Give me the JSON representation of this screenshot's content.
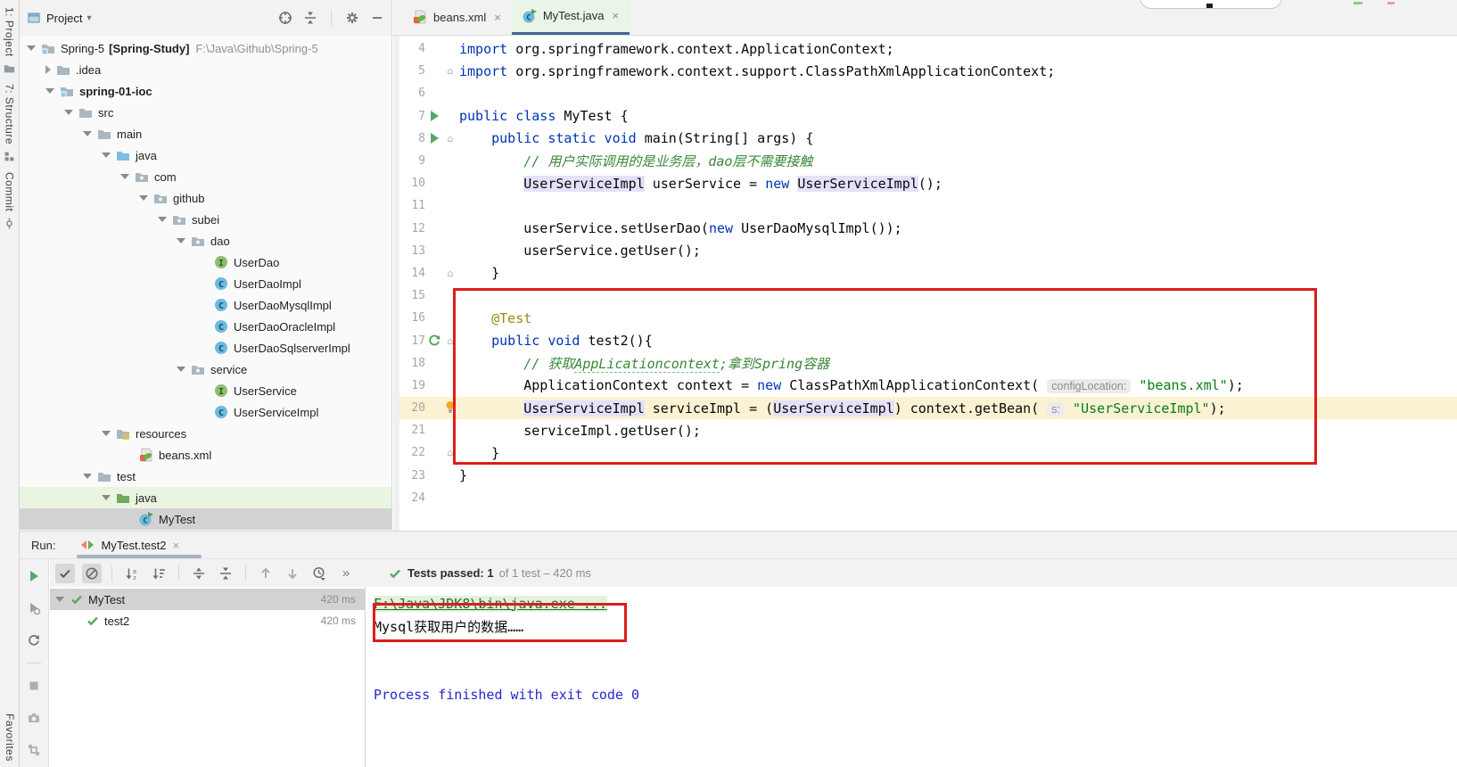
{
  "left_bar": {
    "top_items": [
      {
        "label": "1: Project",
        "icon": "folder-mini"
      },
      {
        "label": "7: Structure",
        "icon": "structure"
      },
      {
        "label": "Commit",
        "icon": "commit"
      }
    ],
    "bottom_items": [
      {
        "label": "Favorites",
        "icon": null
      }
    ]
  },
  "project_panel": {
    "title": "Project",
    "caret": "▾",
    "actions": [
      "target",
      "collapse-all",
      "sep",
      "gear",
      "minimize"
    ],
    "tree": [
      {
        "indent": 0,
        "chevron": "open",
        "icon": "module",
        "label": "Spring-5",
        "extra": "[Spring-Study]",
        "path": "F:\\Java\\Github\\Spring-5"
      },
      {
        "indent": 1,
        "chevron": "closed",
        "icon": "folder",
        "label": ".idea"
      },
      {
        "indent": 1,
        "chevron": "open",
        "icon": "module",
        "label": "spring-01-ioc",
        "bold": true
      },
      {
        "indent": 2,
        "chevron": "open",
        "icon": "folder",
        "label": "src"
      },
      {
        "indent": 3,
        "chevron": "open",
        "icon": "folder",
        "label": "main"
      },
      {
        "indent": 4,
        "chevron": "open",
        "icon": "folder-blue",
        "label": "java"
      },
      {
        "indent": 5,
        "chevron": "open",
        "icon": "package",
        "label": "com"
      },
      {
        "indent": 6,
        "chevron": "open",
        "icon": "package",
        "label": "github"
      },
      {
        "indent": 7,
        "chevron": "open",
        "icon": "package",
        "label": "subei"
      },
      {
        "indent": 8,
        "chevron": "open",
        "icon": "package",
        "label": "dao"
      },
      {
        "indent": 9,
        "chevron": "none",
        "icon": "interface",
        "label": "UserDao"
      },
      {
        "indent": 9,
        "chevron": "none",
        "icon": "class",
        "label": "UserDaoImpl"
      },
      {
        "indent": 9,
        "chevron": "none",
        "icon": "class",
        "label": "UserDaoMysqlImpl"
      },
      {
        "indent": 9,
        "chevron": "none",
        "icon": "class",
        "label": "UserDaoOracleImpl"
      },
      {
        "indent": 9,
        "chevron": "none",
        "icon": "class",
        "label": "UserDaoSqlserverImpl"
      },
      {
        "indent": 8,
        "chevron": "open",
        "icon": "package",
        "label": "service"
      },
      {
        "indent": 9,
        "chevron": "none",
        "icon": "interface",
        "label": "UserService"
      },
      {
        "indent": 9,
        "chevron": "none",
        "icon": "class",
        "label": "UserServiceImpl"
      },
      {
        "indent": 4,
        "chevron": "open",
        "icon": "resources",
        "label": "resources"
      },
      {
        "indent": 5,
        "chevron": "none",
        "icon": "spring",
        "label": "beans.xml"
      },
      {
        "indent": 3,
        "chevron": "open",
        "icon": "folder",
        "label": "test"
      },
      {
        "indent": 4,
        "chevron": "open",
        "icon": "folder-green",
        "label": "java",
        "row": "green"
      },
      {
        "indent": 5,
        "chevron": "none",
        "icon": "class-run",
        "label": "MyTest",
        "row": "selected"
      }
    ]
  },
  "editor": {
    "tabs": [
      {
        "label": "beans.xml",
        "icon": "spring",
        "close": "×",
        "active": false
      },
      {
        "label": "MyTest.java",
        "icon": "class-run",
        "close": "×",
        "active": true
      }
    ],
    "lines": [
      {
        "n": 4,
        "seg": [
          {
            "t": "import",
            "c": "kw"
          },
          {
            "t": " org.springframework.context.ApplicationContext;",
            "c": "pl"
          }
        ]
      },
      {
        "n": 5,
        "fold": true,
        "seg": [
          {
            "t": "import",
            "c": "kw"
          },
          {
            "t": " org.springframework.context.support.ClassPathXmlApplicationContext;",
            "c": "pl"
          }
        ]
      },
      {
        "n": 6,
        "seg": []
      },
      {
        "n": 7,
        "g": "play-green",
        "seg": [
          {
            "t": "public class",
            "c": "kw"
          },
          {
            "t": " MyTest {",
            "c": "pl"
          }
        ]
      },
      {
        "n": 8,
        "g": "play-green",
        "fold": true,
        "seg": [
          {
            "t": "    ",
            "c": "pl"
          },
          {
            "t": "public static void",
            "c": "kw"
          },
          {
            "t": " main(String[] args) {",
            "c": "pl"
          }
        ]
      },
      {
        "n": 9,
        "seg": [
          {
            "t": "        ",
            "c": "pl"
          },
          {
            "t": "// 用户实际调用的是业务层，dao层不需要接触",
            "c": "cm"
          }
        ]
      },
      {
        "n": 10,
        "seg": [
          {
            "t": "        ",
            "c": "pl"
          },
          {
            "t": "UserServiceImpl",
            "c": "hl"
          },
          {
            "t": " userService = ",
            "c": "pl"
          },
          {
            "t": "new",
            "c": "kw"
          },
          {
            "t": " ",
            "c": "pl"
          },
          {
            "t": "UserServiceImpl",
            "c": "hl"
          },
          {
            "t": "();",
            "c": "pl"
          }
        ]
      },
      {
        "n": 11,
        "seg": []
      },
      {
        "n": 12,
        "seg": [
          {
            "t": "        userService.setUserDao(",
            "c": "pl"
          },
          {
            "t": "new",
            "c": "kw"
          },
          {
            "t": " UserDaoMysqlImpl());",
            "c": "pl"
          }
        ]
      },
      {
        "n": 13,
        "seg": [
          {
            "t": "        userService.getUser();",
            "c": "pl"
          }
        ]
      },
      {
        "n": 14,
        "fold": true,
        "seg": [
          {
            "t": "    }",
            "c": "pl"
          }
        ]
      },
      {
        "n": 15,
        "seg": []
      },
      {
        "n": 16,
        "seg": [
          {
            "t": "    ",
            "c": "pl"
          },
          {
            "t": "@Test",
            "c": "ann"
          }
        ]
      },
      {
        "n": 17,
        "g": "rerun-green",
        "fold": true,
        "seg": [
          {
            "t": "    ",
            "c": "pl"
          },
          {
            "t": "public void",
            "c": "kw"
          },
          {
            "t": " test2(){",
            "c": "pl"
          }
        ]
      },
      {
        "n": 18,
        "seg": [
          {
            "t": "        ",
            "c": "pl"
          },
          {
            "t": "// 获取",
            "c": "cm"
          },
          {
            "t": "AppLicationcontext",
            "c": "cmu"
          },
          {
            "t": ";拿到Spring容器",
            "c": "cm"
          }
        ]
      },
      {
        "n": 19,
        "seg": [
          {
            "t": "        ApplicationContext context = ",
            "c": "pl"
          },
          {
            "t": "new",
            "c": "kw"
          },
          {
            "t": " ClassPathXmlApplicationContext( ",
            "c": "pl"
          },
          {
            "t": "configLocation:",
            "c": "hint"
          },
          {
            "t": " ",
            "c": "pl"
          },
          {
            "t": "\"beans.xml\"",
            "c": "str"
          },
          {
            "t": ");",
            "c": "pl"
          }
        ]
      },
      {
        "n": 20,
        "current": true,
        "bulb": true,
        "seg": [
          {
            "t": "        ",
            "c": "pl"
          },
          {
            "t": "UserServiceImpl",
            "c": "hl"
          },
          {
            "t": " serviceImpl = (",
            "c": "pl"
          },
          {
            "t": "UserServiceImpl",
            "c": "hl"
          },
          {
            "t": ") context.getBean( ",
            "c": "pl"
          },
          {
            "t": "s:",
            "c": "hint"
          },
          {
            "t": " ",
            "c": "pl"
          },
          {
            "t": "\"UserServiceImpl\"",
            "c": "str"
          },
          {
            "t": ");",
            "c": "pl"
          }
        ]
      },
      {
        "n": 21,
        "seg": [
          {
            "t": "        serviceImpl.getUser();",
            "c": "pl"
          }
        ]
      },
      {
        "n": 22,
        "fold": true,
        "seg": [
          {
            "t": "    }",
            "c": "pl"
          }
        ]
      },
      {
        "n": 23,
        "seg": [
          {
            "t": "}",
            "c": "pl"
          }
        ]
      },
      {
        "n": 24,
        "seg": []
      }
    ]
  },
  "run_panel": {
    "label": "Run:",
    "tab": {
      "label": "MyTest.test2",
      "icon": "junit",
      "close": "×"
    },
    "strip": [
      "play-green",
      "rerun-failed",
      "refresh",
      "sep",
      "stop",
      "camera",
      "gc"
    ],
    "toolbar": [
      {
        "name": "show-passed",
        "icon": "check",
        "toggled": true
      },
      {
        "name": "show-ignored",
        "icon": "nocircle",
        "toggled": true
      },
      {
        "sep": true
      },
      {
        "name": "sort-alphabetically",
        "icon": "sort-alpha"
      },
      {
        "sep2": false,
        "name": "sort-by-duration",
        "icon": "sort-duration"
      },
      {
        "sep": true
      },
      {
        "name": "expand-all",
        "icon": "expand"
      },
      {
        "name": "collapse-all2",
        "icon": "collapse-all"
      },
      {
        "sep": true
      },
      {
        "name": "previous-test",
        "icon": "arrow-up",
        "disabled": true
      },
      {
        "name": "next-test",
        "icon": "arrow-down",
        "disabled": true
      },
      {
        "name": "test-history",
        "icon": "clock-caret"
      },
      {
        "name": "more-actions",
        "icon": "chevrons"
      }
    ],
    "status": {
      "icon": "check-green",
      "bold": "Tests passed: 1",
      "gray": "of 1 test – 420 ms"
    },
    "test_tree": [
      {
        "chevron": true,
        "icon": "check-green",
        "label": "MyTest",
        "time": "420 ms",
        "selected": true
      },
      {
        "chevron": false,
        "icon": "check-green",
        "label": "test2",
        "time": "420 ms",
        "indent": true
      }
    ],
    "console": [
      {
        "text": "F:\\Java\\JDK8\\bin\\java.exe ...",
        "style": "cmd"
      },
      {
        "text": "Mysql获取用户的数据……",
        "style": "out"
      },
      {
        "text": "",
        "style": "blank"
      },
      {
        "text": "",
        "style": "blank"
      },
      {
        "text": "Process finished with exit code 0",
        "style": "sys"
      }
    ]
  }
}
